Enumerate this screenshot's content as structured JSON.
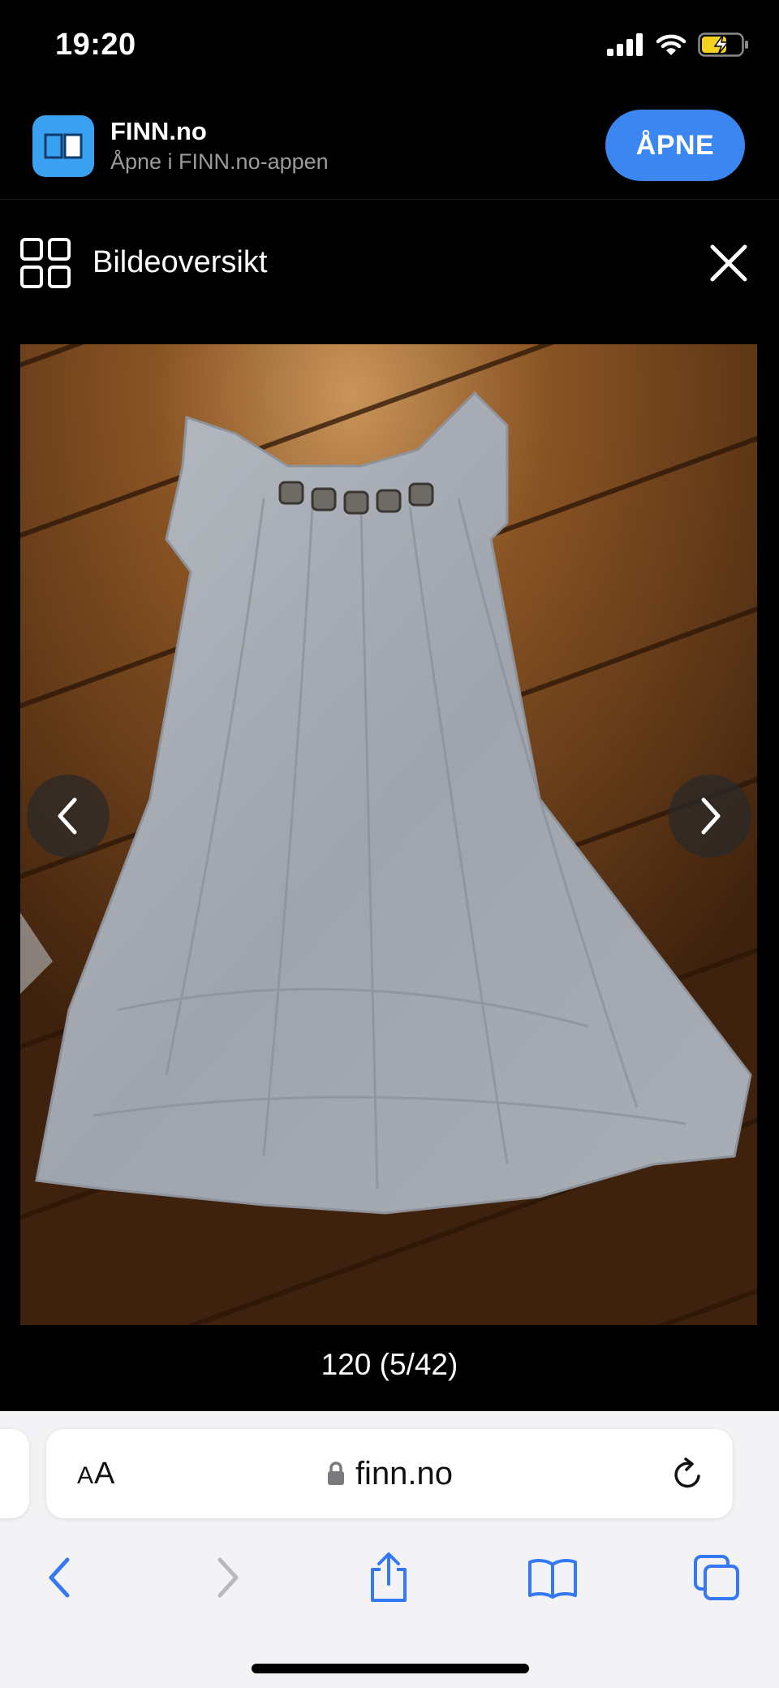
{
  "status_bar": {
    "time": "19:20"
  },
  "app_banner": {
    "app_name": "FINN.no",
    "subtitle": "Åpne i FINN.no-appen",
    "open_label": "ÅPNE"
  },
  "viewer": {
    "title": "Bildeoversikt",
    "caption": "120 (5/42)"
  },
  "browser": {
    "aa_label_small": "A",
    "aa_label_large": "A",
    "url": "finn.no"
  },
  "icons": {
    "signal": "cellular-signal-icon",
    "wifi": "wifi-icon",
    "battery": "battery-charging-icon",
    "app": "finn-app-icon",
    "grid": "grid-icon",
    "close": "close-icon",
    "prev": "chevron-left-icon",
    "next": "chevron-right-icon",
    "lock": "lock-icon",
    "reload": "reload-icon",
    "back": "back-icon",
    "forward": "forward-icon",
    "share": "share-icon",
    "bookmarks": "bookmarks-icon",
    "tabs": "tabs-icon"
  },
  "colors": {
    "accent": "#3b86f0",
    "safari_blue": "#3478f6",
    "battery": "#f5d020"
  }
}
